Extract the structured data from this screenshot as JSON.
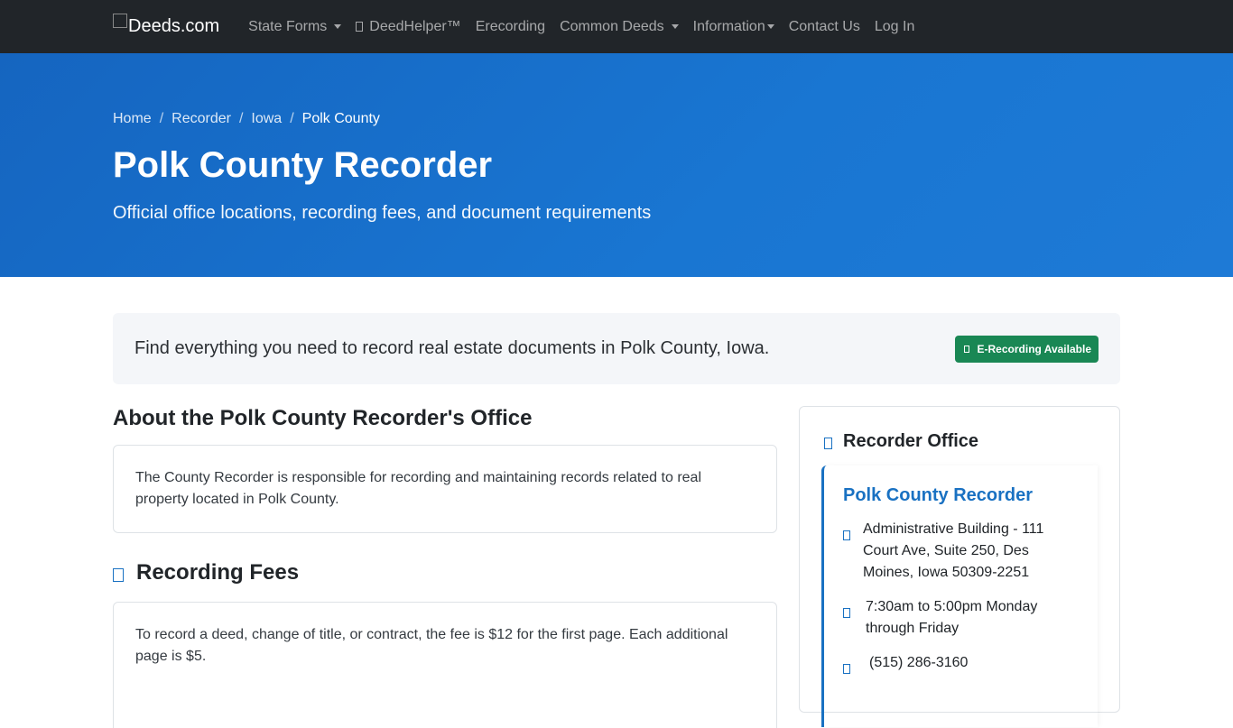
{
  "nav": {
    "brand": "Deeds.com",
    "items": [
      {
        "label": "State Forms",
        "dropdown": true
      },
      {
        "label": "DeedHelper™",
        "icon": "robot-icon",
        "dropdown": false
      },
      {
        "label": "Erecording",
        "dropdown": false
      },
      {
        "label": "Common Deeds",
        "dropdown": true
      },
      {
        "label": "Information",
        "dropdown": true
      },
      {
        "label": "Contact Us",
        "dropdown": false
      },
      {
        "label": "Log In",
        "dropdown": false
      }
    ]
  },
  "breadcrumb": [
    "Home",
    "Recorder",
    "Iowa",
    "Polk County"
  ],
  "hero": {
    "title": "Polk County Recorder",
    "subtitle": "Official office locations, recording fees, and document requirements"
  },
  "intro": {
    "text": "Find everything you need to record real estate documents in Polk County, Iowa.",
    "badge": "E-Recording Available"
  },
  "about": {
    "heading": "About the Polk County Recorder's Office",
    "body": "The County Recorder is responsible for recording and maintaining records related to real property located in Polk County."
  },
  "fees": {
    "heading": "Recording Fees",
    "body": "To record a deed, change of title, or contract, the fee is $12 for the first page. Each additional page is $5."
  },
  "sidebar": {
    "heading": "Recorder Office",
    "office_name": "Polk County Recorder",
    "address": "Administrative Building - 111 Court Ave, Suite 250, Des Moines, Iowa 50309-2251",
    "hours": "7:30am to 5:00pm Monday through Friday",
    "phone": "(515) 286-3160"
  },
  "colors": {
    "navbar": "#212529",
    "hero": "#1976d2",
    "accent": "#1971c2",
    "badge": "#198754"
  }
}
